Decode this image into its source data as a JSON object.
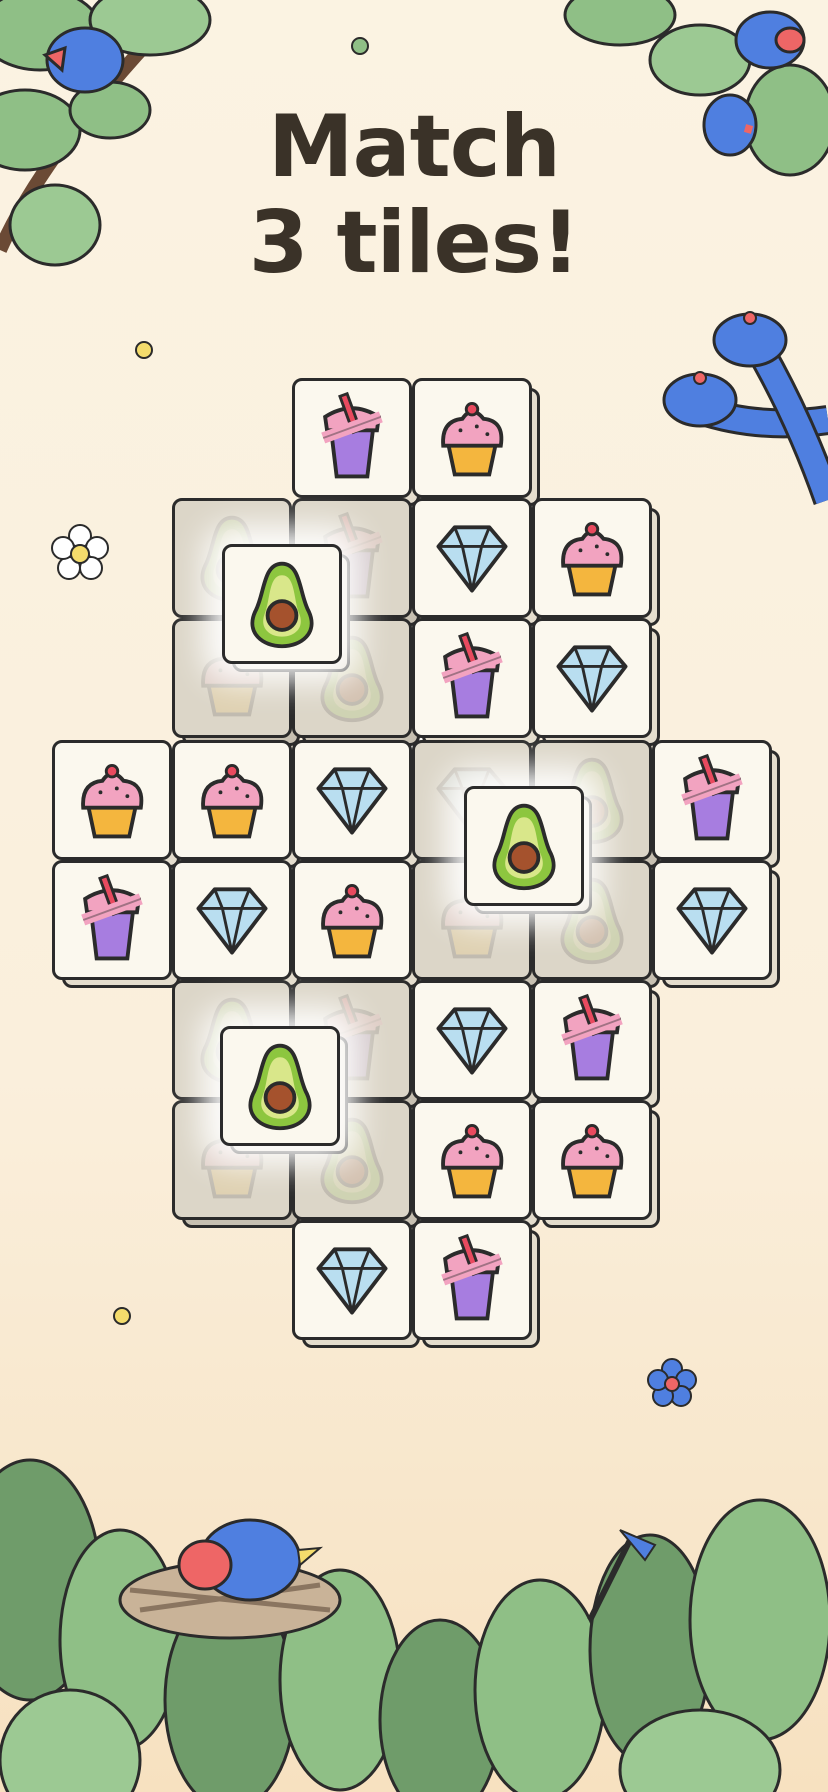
{
  "headline": {
    "line1": "Match",
    "line2": "3 tiles!"
  },
  "colors": {
    "background": "#fbf3e2",
    "text": "#3a3228",
    "tile_face": "#fbf8ee",
    "leaf": "#8fbf86",
    "bird": "#4f7fe0"
  },
  "board": {
    "tiles": [
      {
        "icon": "boba-icon",
        "row": 0,
        "col": 2,
        "state": "normal"
      },
      {
        "icon": "cupcake-icon",
        "row": 0,
        "col": 3,
        "state": "normal"
      },
      {
        "icon": "avocado-icon",
        "row": 1,
        "col": 1,
        "state": "dim"
      },
      {
        "icon": "boba-icon",
        "row": 1,
        "col": 2,
        "state": "dim"
      },
      {
        "icon": "diamond-icon",
        "row": 1,
        "col": 3,
        "state": "normal"
      },
      {
        "icon": "cupcake-icon",
        "row": 1,
        "col": 4,
        "state": "normal"
      },
      {
        "icon": "cupcake-icon",
        "row": 2,
        "col": 1,
        "state": "dim"
      },
      {
        "icon": "avocado-icon",
        "row": 2,
        "col": 2,
        "state": "dim"
      },
      {
        "icon": "boba-icon",
        "row": 2,
        "col": 3,
        "state": "normal"
      },
      {
        "icon": "diamond-icon",
        "row": 2,
        "col": 4,
        "state": "normal"
      },
      {
        "icon": "cupcake-icon",
        "row": 3,
        "col": 0,
        "state": "normal"
      },
      {
        "icon": "cupcake-icon",
        "row": 3,
        "col": 1,
        "state": "normal"
      },
      {
        "icon": "diamond-icon",
        "row": 3,
        "col": 2,
        "state": "normal"
      },
      {
        "icon": "diamond-icon",
        "row": 3,
        "col": 3,
        "state": "dim"
      },
      {
        "icon": "avocado-icon",
        "row": 3,
        "col": 4,
        "state": "dim"
      },
      {
        "icon": "boba-icon",
        "row": 3,
        "col": 5,
        "state": "normal"
      },
      {
        "icon": "boba-icon",
        "row": 4,
        "col": 0,
        "state": "normal"
      },
      {
        "icon": "diamond-icon",
        "row": 4,
        "col": 1,
        "state": "normal"
      },
      {
        "icon": "cupcake-icon",
        "row": 4,
        "col": 2,
        "state": "normal"
      },
      {
        "icon": "cupcake-icon",
        "row": 4,
        "col": 3,
        "state": "dim"
      },
      {
        "icon": "avocado-icon",
        "row": 4,
        "col": 4,
        "state": "dim"
      },
      {
        "icon": "diamond-icon",
        "row": 4,
        "col": 5,
        "state": "normal"
      },
      {
        "icon": "avocado-icon",
        "row": 5,
        "col": 1,
        "state": "dim"
      },
      {
        "icon": "boba-icon",
        "row": 5,
        "col": 2,
        "state": "dim"
      },
      {
        "icon": "diamond-icon",
        "row": 5,
        "col": 3,
        "state": "normal"
      },
      {
        "icon": "boba-icon",
        "row": 5,
        "col": 4,
        "state": "normal"
      },
      {
        "icon": "cupcake-icon",
        "row": 6,
        "col": 1,
        "state": "dim"
      },
      {
        "icon": "avocado-icon",
        "row": 6,
        "col": 2,
        "state": "dim"
      },
      {
        "icon": "cupcake-icon",
        "row": 6,
        "col": 3,
        "state": "normal"
      },
      {
        "icon": "cupcake-icon",
        "row": 6,
        "col": 4,
        "state": "normal"
      },
      {
        "icon": "diamond-icon",
        "row": 7,
        "col": 2,
        "state": "normal"
      },
      {
        "icon": "boba-icon",
        "row": 7,
        "col": 3,
        "state": "normal"
      }
    ],
    "highlighted": [
      {
        "icon": "avocado-icon"
      },
      {
        "icon": "avocado-icon"
      },
      {
        "icon": "avocado-icon"
      }
    ]
  }
}
